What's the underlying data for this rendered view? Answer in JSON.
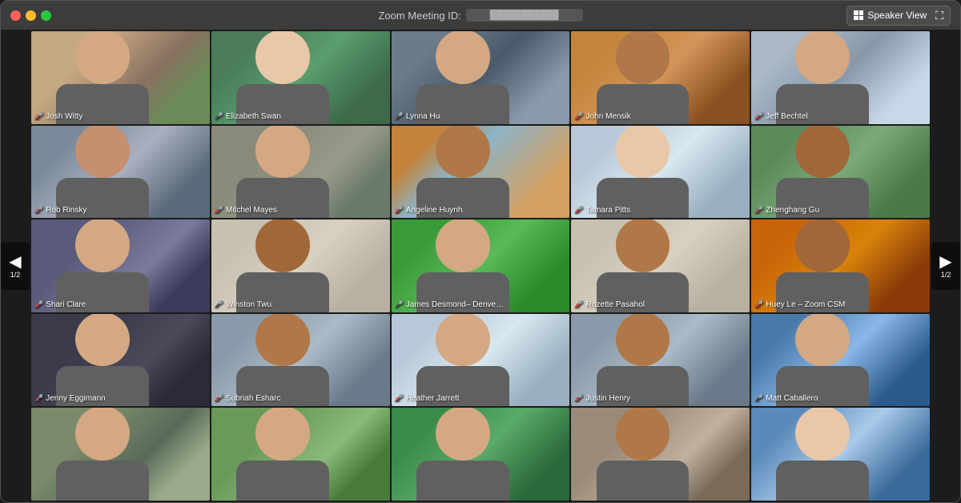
{
  "window": {
    "title": "Zoom Meeting ID:",
    "meeting_id": "███████████",
    "speaker_view_label": "Speaker View"
  },
  "nav": {
    "left_page": "1/2",
    "right_page": "1/2"
  },
  "participants": [
    {
      "id": "josh-witty",
      "name": "Josh Witty",
      "muted": true,
      "bg": "bg-office-warm",
      "skin": "skin-2",
      "row": 1,
      "col": 1
    },
    {
      "id": "elizabeth-swan",
      "name": "Elizabeth Swan",
      "muted": false,
      "bg": "bg-green-screen",
      "skin": "skin-4",
      "row": 1,
      "col": 2
    },
    {
      "id": "lynna-hu",
      "name": "Lynna Hu",
      "muted": false,
      "bg": "bg-office-dark",
      "skin": "skin-2",
      "row": 1,
      "col": 3
    },
    {
      "id": "john-mensik",
      "name": "John Mensik",
      "muted": true,
      "bg": "bg-orange-warm",
      "skin": "skin-3",
      "row": 1,
      "col": 4
    },
    {
      "id": "jeff-bechtel",
      "name": "Jeff Bechtel",
      "muted": true,
      "bg": "bg-office-bright",
      "skin": "skin-2",
      "row": 1,
      "col": 5
    },
    {
      "id": "rob-rinsky",
      "name": "Rob Rinsky",
      "muted": true,
      "bg": "bg-home",
      "skin": "skin-1",
      "row": 2,
      "col": 1
    },
    {
      "id": "mitchel-mayes",
      "name": "Mitchel Mayes",
      "muted": true,
      "bg": "bg-office-medium",
      "skin": "skin-2",
      "row": 2,
      "col": 2
    },
    {
      "id": "angeline-huynh",
      "name": "Angeline Huynh",
      "muted": true,
      "bg": "bg-beach",
      "skin": "skin-3",
      "row": 2,
      "col": 3
    },
    {
      "id": "tamara-pitts",
      "name": "Tamara Pitts",
      "muted": true,
      "bg": "bg-office-light",
      "skin": "skin-4",
      "row": 2,
      "col": 4
    },
    {
      "id": "zhenghang-gu",
      "name": "Zhenghang Gu",
      "muted": true,
      "bg": "bg-office-green",
      "skin": "skin-5",
      "row": 2,
      "col": 5
    },
    {
      "id": "shari-clare",
      "name": "Shari Clare",
      "muted": true,
      "bg": "bg-studio",
      "skin": "skin-2",
      "row": 3,
      "col": 1
    },
    {
      "id": "winston-twu",
      "name": "Winston Twu",
      "muted": false,
      "bg": "bg-office-beige",
      "skin": "skin-5",
      "row": 3,
      "col": 2
    },
    {
      "id": "james-desmond",
      "name": "James Desmond– Denve…",
      "muted": false,
      "bg": "bg-greenscreen2",
      "skin": "skin-2",
      "row": 3,
      "col": 3
    },
    {
      "id": "rozette-pasahol",
      "name": "Rozette Pasahol",
      "muted": true,
      "bg": "bg-office-beige",
      "skin": "skin-3",
      "row": 3,
      "col": 4
    },
    {
      "id": "huey-le",
      "name": "Huey Le – Zoom CSM",
      "muted": true,
      "bg": "bg-fall",
      "skin": "skin-5",
      "row": 3,
      "col": 5
    },
    {
      "id": "jenny-eggimann",
      "name": "Jenny Eggimann",
      "muted": true,
      "bg": "bg-dark-room",
      "skin": "skin-2",
      "row": 4,
      "col": 1
    },
    {
      "id": "subriah-esharc",
      "name": "Subriah Esharc",
      "muted": true,
      "bg": "bg-office-grey",
      "skin": "skin-3",
      "row": 4,
      "col": 2
    },
    {
      "id": "heather-jarrett",
      "name": "Heather Jarrett",
      "muted": true,
      "bg": "bg-office-light",
      "skin": "skin-2",
      "row": 4,
      "col": 3
    },
    {
      "id": "justin-henry",
      "name": "Justin Henry",
      "muted": true,
      "bg": "bg-office-grey",
      "skin": "skin-3",
      "row": 4,
      "col": 4
    },
    {
      "id": "matt-caballero",
      "name": "Matt Caballero",
      "muted": false,
      "bg": "bg-mountains",
      "skin": "skin-2",
      "row": 4,
      "col": 5
    },
    {
      "id": "partial-1",
      "name": "",
      "muted": false,
      "bg": "bg-partial",
      "skin": "skin-2",
      "row": 5,
      "col": 1
    },
    {
      "id": "partial-2",
      "name": "",
      "muted": false,
      "bg": "bg-outdoor",
      "skin": "skin-2",
      "row": 5,
      "col": 2
    },
    {
      "id": "partial-3",
      "name": "",
      "muted": false,
      "bg": "bg-green3",
      "skin": "skin-2",
      "row": 5,
      "col": 3
    },
    {
      "id": "partial-4",
      "name": "",
      "muted": false,
      "bg": "bg-office-corner",
      "skin": "skin-3",
      "row": 5,
      "col": 4
    },
    {
      "id": "partial-5",
      "name": "",
      "muted": false,
      "bg": "bg-mountains2",
      "skin": "skin-4",
      "row": 5,
      "col": 5
    }
  ]
}
